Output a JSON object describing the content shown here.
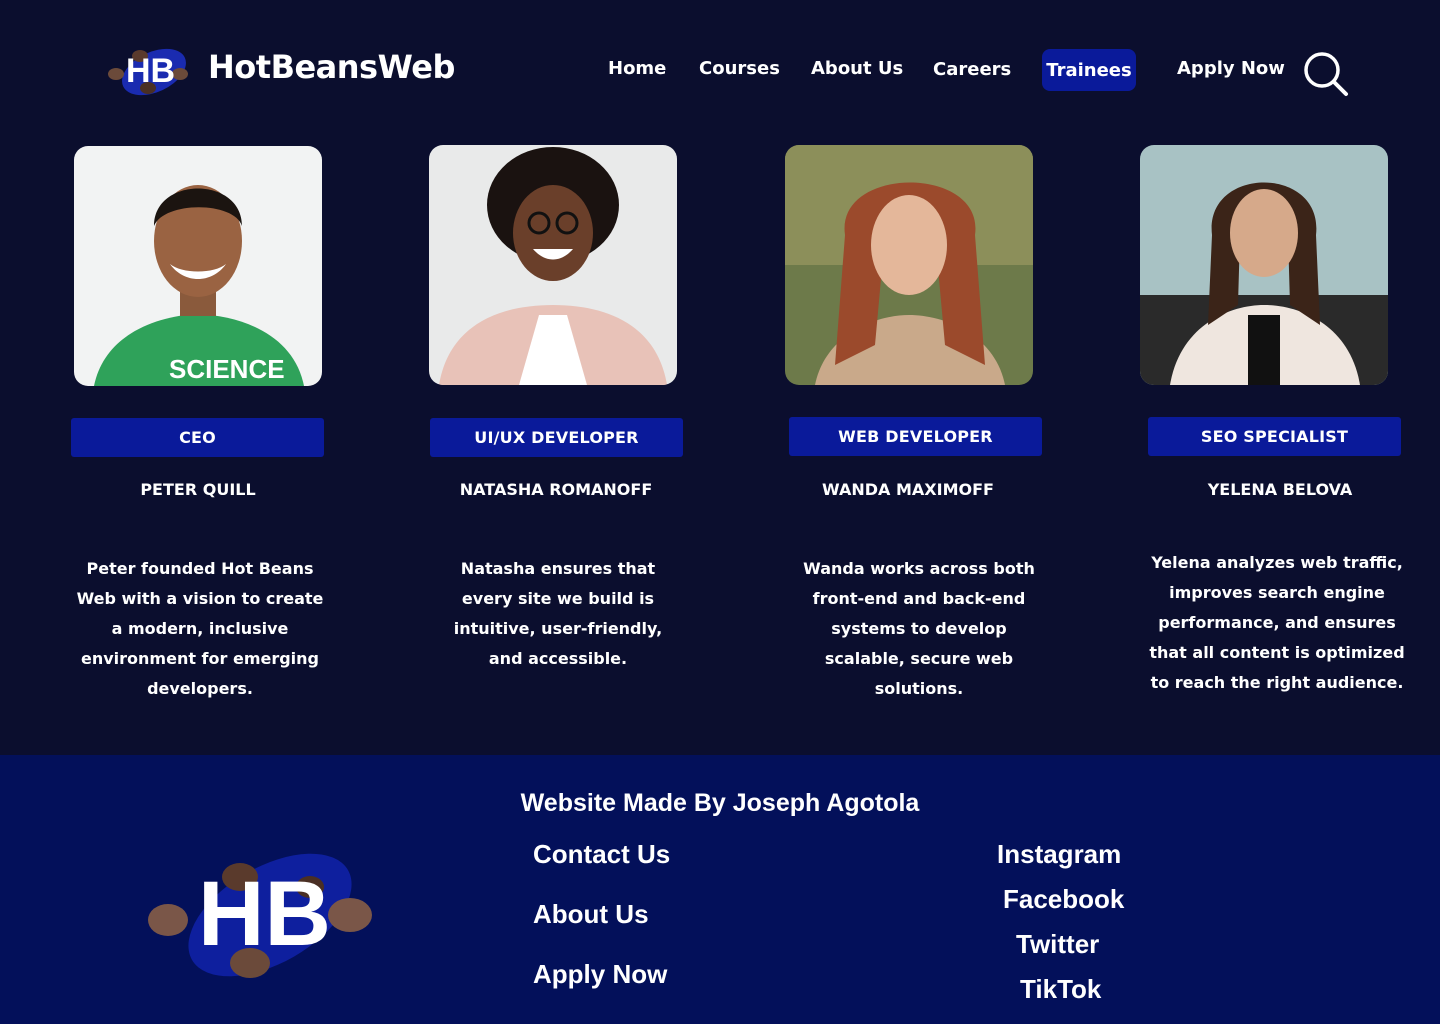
{
  "header": {
    "brand_name": "HotBeansWeb",
    "nav": [
      {
        "label": "Home"
      },
      {
        "label": "Courses"
      },
      {
        "label": "About Us"
      },
      {
        "label": "Careers"
      },
      {
        "label": "Trainees",
        "active": true
      },
      {
        "label": "Apply Now"
      }
    ],
    "search_icon": "search-icon"
  },
  "team": [
    {
      "role": "CEO",
      "name": "PETER QUILL",
      "bio": "Peter founded Hot Beans Web with a vision to create a modern, inclusive environment for emerging developers."
    },
    {
      "role": "UI/UX DEVELOPER",
      "name": "NATASHA ROMANOFF",
      "bio": "Natasha ensures that every site we build is intuitive, user-friendly, and accessible."
    },
    {
      "role": "WEB DEVELOPER",
      "name": "WANDA MAXIMOFF",
      "bio": "Wanda works across both front-end and back-end systems to develop scalable, secure web solutions."
    },
    {
      "role": "SEO SPECIALIST",
      "name": "YELENA BELOVA",
      "bio": "Yelena analyzes web traffic, improves search engine performance, and ensures that all content is optimized to reach the right audience."
    }
  ],
  "footer": {
    "credit": "Website Made By Joseph Agotola",
    "links": [
      {
        "label": "Contact Us"
      },
      {
        "label": "About Us"
      },
      {
        "label": "Apply Now"
      }
    ],
    "social": [
      {
        "label": "Instagram"
      },
      {
        "label": "Facebook"
      },
      {
        "label": "Twitter"
      },
      {
        "label": "TikTok"
      }
    ],
    "logo_text": "HB"
  },
  "colors": {
    "page_bg": "#0b0e2e",
    "accent": "#0a1a9a",
    "footer_bg": "#03105a"
  }
}
